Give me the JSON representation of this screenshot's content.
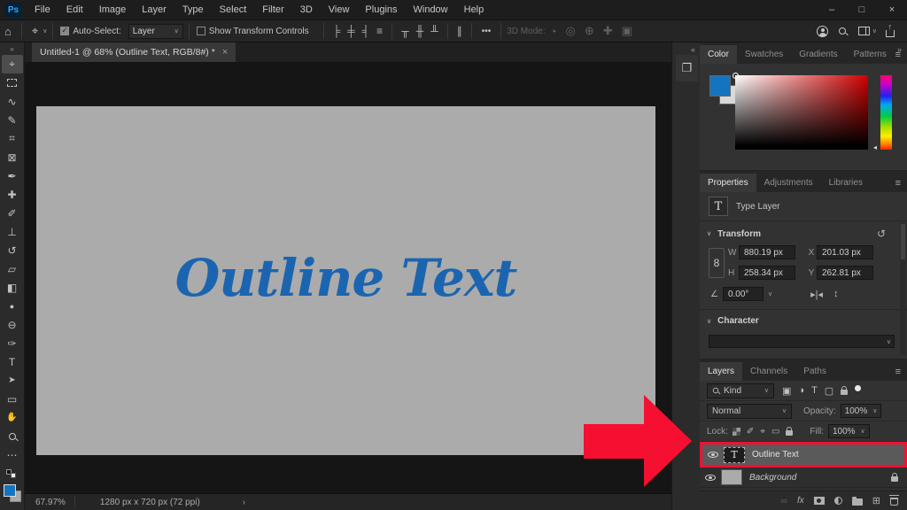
{
  "menubar": {
    "logo": "Ps",
    "items": [
      "File",
      "Edit",
      "Image",
      "Layer",
      "Type",
      "Select",
      "Filter",
      "3D",
      "View",
      "Plugins",
      "Window",
      "Help"
    ],
    "window_controls": {
      "minimize": "–",
      "maximize": "□",
      "close": "×"
    }
  },
  "options": {
    "home_icon": "⌂",
    "move_tool_icon": "⌖",
    "auto_select_label": "Auto-Select:",
    "auto_select_value": "Layer",
    "show_transform_label": "Show Transform Controls",
    "align_icons": [
      "╞",
      "╪",
      "╡",
      "≡",
      "╥",
      "╫",
      "╨",
      "∥"
    ],
    "more": "•••",
    "mode3d_label": "3D Mode:",
    "mode3d_icons": [
      "◔",
      "◎",
      "⊕",
      "✚",
      "▣"
    ]
  },
  "document_tab": {
    "title": "Untitled-1 @ 68% (Outline Text, RGB/8#) *",
    "close": "×"
  },
  "toolbar": {
    "collapse": "»",
    "tools": [
      {
        "name": "move-tool",
        "glyph": "⌖"
      },
      {
        "name": "marquee-tool",
        "glyph": ""
      },
      {
        "name": "lasso-tool",
        "glyph": "∿"
      },
      {
        "name": "quick-selection-tool",
        "glyph": "✎"
      },
      {
        "name": "crop-tool",
        "glyph": "⌗"
      },
      {
        "name": "frame-tool",
        "glyph": "⊠"
      },
      {
        "name": "eyedropper-tool",
        "glyph": "✒"
      },
      {
        "name": "healing-brush-tool",
        "glyph": "✚"
      },
      {
        "name": "brush-tool",
        "glyph": "✐"
      },
      {
        "name": "clone-stamp-tool",
        "glyph": "⊥"
      },
      {
        "name": "history-brush-tool",
        "glyph": "↺"
      },
      {
        "name": "eraser-tool",
        "glyph": "▱"
      },
      {
        "name": "gradient-tool",
        "glyph": "◧"
      },
      {
        "name": "blur-tool",
        "glyph": "●"
      },
      {
        "name": "dodge-tool",
        "glyph": "⊖"
      },
      {
        "name": "pen-tool",
        "glyph": "✑"
      },
      {
        "name": "type-tool",
        "glyph": "T"
      },
      {
        "name": "path-selection-tool",
        "glyph": "➤"
      },
      {
        "name": "rectangle-tool",
        "glyph": "▭"
      },
      {
        "name": "hand-tool",
        "glyph": "✋"
      },
      {
        "name": "zoom-tool",
        "glyph": ""
      },
      {
        "name": "more-tools",
        "glyph": "⋯"
      }
    ]
  },
  "canvas": {
    "text": "Outline Text"
  },
  "statusbar": {
    "zoom": "67.97%",
    "doc_info": "1280 px x 720 px (72 ppi)",
    "chevron": "›"
  },
  "dock": {
    "collapse": "«",
    "history_icon": "❐"
  },
  "panels_collapse": "»",
  "color_panel": {
    "tabs": [
      "Color",
      "Swatches",
      "Gradients",
      "Patterns"
    ],
    "menu_icon": "≡",
    "hue_marker": "◂"
  },
  "properties_panel": {
    "tabs": [
      "Properties",
      "Adjustments",
      "Libraries"
    ],
    "menu_icon": "≡",
    "type_icon": "T",
    "layer_type": "Type Layer",
    "transform": {
      "title": "Transform",
      "collapse_chevron": "∨",
      "reset_icon": "↺",
      "link_icon": "8",
      "w_label": "W",
      "w_value": "880.19 px",
      "x_label": "X",
      "x_value": "201.03 px",
      "h_label": "H",
      "h_value": "258.34 px",
      "y_label": "Y",
      "y_value": "262.81 px",
      "angle_icon": "∠",
      "angle_value": "0.00°",
      "flip_h_icon": "▸|◂",
      "flip_v_icon": "↕"
    },
    "character": {
      "title": "Character",
      "collapse_chevron": "∨"
    }
  },
  "layers_panel": {
    "tabs": [
      "Layers",
      "Channels",
      "Paths"
    ],
    "menu_icon": "≡",
    "filter": {
      "kind_label": "Kind",
      "type_icon": "T",
      "image_icon": "▣",
      "adjust_icon": "◑",
      "shape_icon": "▢"
    },
    "blend_mode": "Normal",
    "opacity_label": "Opacity:",
    "opacity_value": "100%",
    "lock_label": "Lock:",
    "lock_brush_icon": "✐",
    "lock_move_icon": "⌖",
    "lock_board_icon": "▭",
    "fill_label": "Fill:",
    "fill_value": "100%",
    "layers": [
      {
        "name": "Outline Text"
      },
      {
        "name": "Background"
      }
    ],
    "bottom_icons": {
      "link": "∞",
      "fx": "fx",
      "new_layer": "⊞"
    }
  },
  "colors": {
    "accent_text_blue": "#1b65b0",
    "foreground_swatch_blue": "#1574c0",
    "annotation_red": "#f50f30",
    "canvas_gray": "#ababab"
  }
}
